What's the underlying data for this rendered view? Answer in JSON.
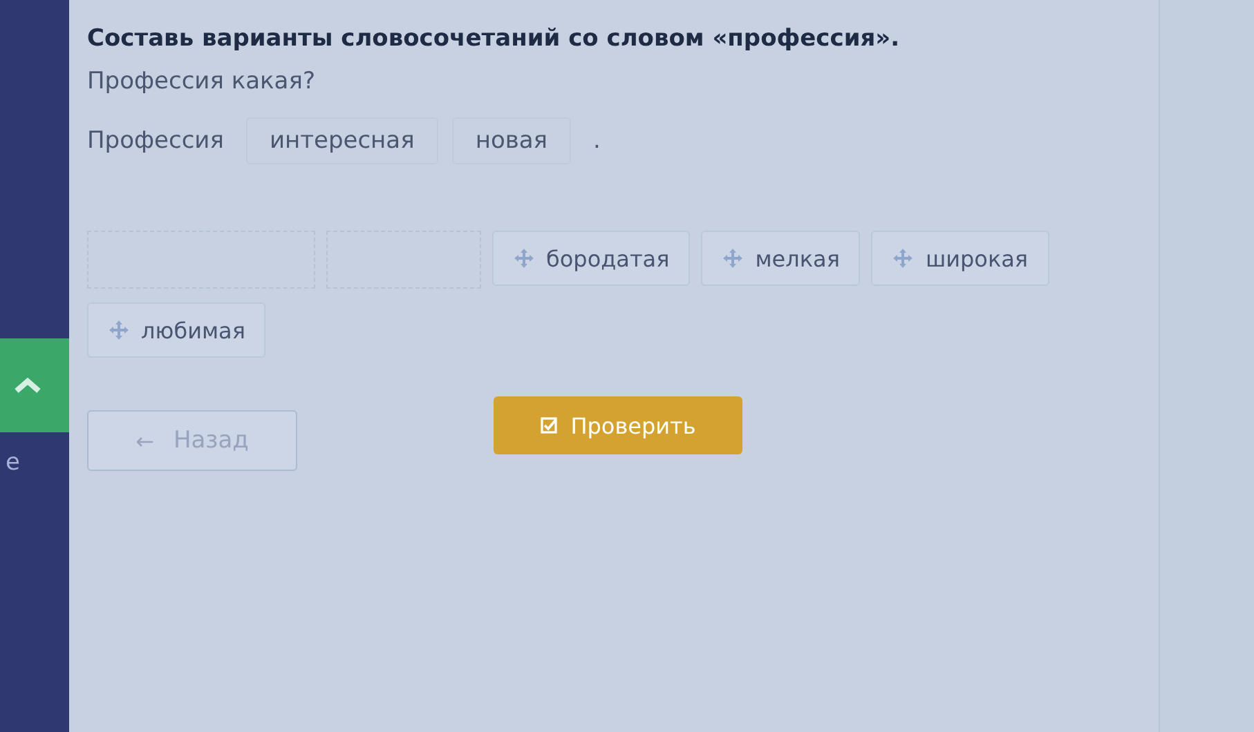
{
  "sidebar": {
    "cut_label": "е"
  },
  "task": {
    "title": "Составь варианты словосочетаний со словом «профессия».",
    "question": "Профессия какая?"
  },
  "answer": {
    "start": "Профессия",
    "placed": [
      "интересная",
      "новая"
    ],
    "end": "."
  },
  "bank": {
    "items": [
      {
        "kind": "empty"
      },
      {
        "kind": "empty"
      },
      {
        "kind": "word",
        "text": "бородатая"
      },
      {
        "kind": "word",
        "text": "мелкая"
      },
      {
        "kind": "word",
        "text": "широкая"
      },
      {
        "kind": "word",
        "text": "любимая"
      }
    ]
  },
  "buttons": [
    {
      "kind": "back",
      "label": "Назад",
      "icon": "←"
    },
    {
      "kind": "check",
      "label": "Проверить"
    }
  ]
}
